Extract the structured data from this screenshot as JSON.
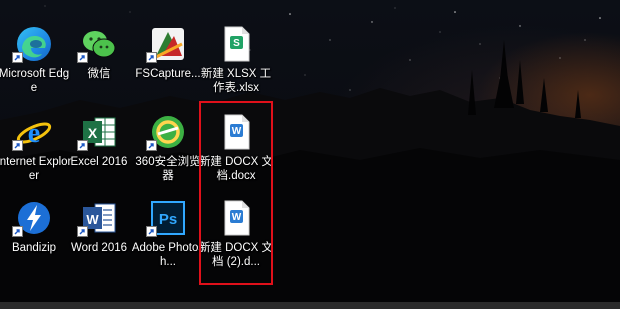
{
  "desktop": {
    "icons": [
      {
        "label": "Microsoft Edge",
        "icon": "edge-icon"
      },
      {
        "label": "微信",
        "icon": "wechat-icon"
      },
      {
        "label": "FSCapture...",
        "icon": "fscapture-icon"
      },
      {
        "label": "新建 XLSX 工作表.xlsx",
        "icon": "xlsx-file-icon"
      },
      {
        "label": "Internet Explorer",
        "icon": "internet-explorer-icon"
      },
      {
        "label": "Excel 2016",
        "icon": "excel-icon"
      },
      {
        "label": "360安全浏览器",
        "icon": "360-browser-icon"
      },
      {
        "label": "新建 DOCX 文档.docx",
        "icon": "docx-file-icon"
      },
      {
        "label": "Bandizip",
        "icon": "bandizip-icon"
      },
      {
        "label": "Word 2016",
        "icon": "word-icon"
      },
      {
        "label": "Adobe Photosh...",
        "icon": "photoshop-icon"
      },
      {
        "label": "新建 DOCX 文档 (2).d...",
        "icon": "docx-file-icon"
      }
    ],
    "highlight_color": "#e0101a"
  }
}
